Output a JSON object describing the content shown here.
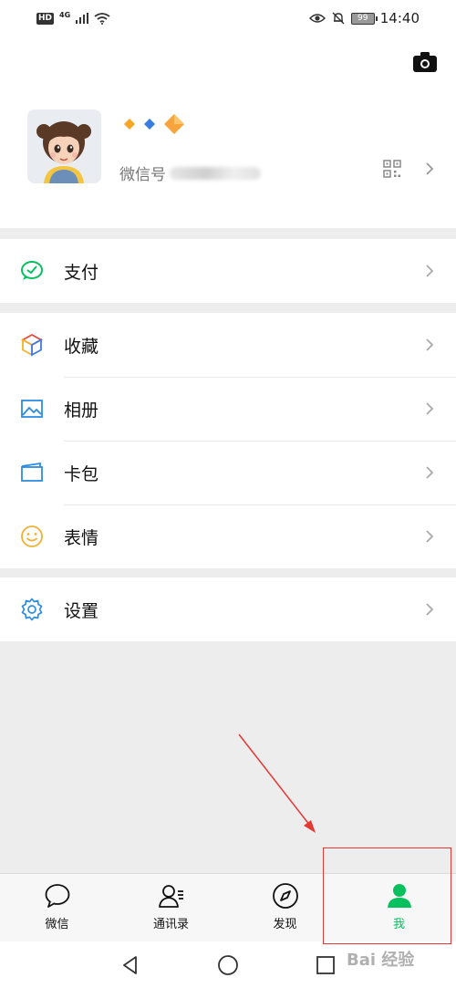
{
  "status_bar": {
    "hd": "HD",
    "network": "4G",
    "battery": "99",
    "time": "14:40"
  },
  "profile": {
    "wechat_id_label": "微信号"
  },
  "menu": {
    "pay": "支付",
    "favorites": "收藏",
    "album": "相册",
    "cards": "卡包",
    "stickers": "表情",
    "settings": "设置"
  },
  "tabs": [
    {
      "label": "微信",
      "icon": "chat-bubble-icon"
    },
    {
      "label": "通讯录",
      "icon": "contacts-icon"
    },
    {
      "label": "发现",
      "icon": "compass-icon"
    },
    {
      "label": "我",
      "icon": "person-icon",
      "active": true
    }
  ],
  "watermark": "Bai 经验",
  "colors": {
    "brand_green": "#07c160",
    "annotation_red": "#e53935"
  }
}
